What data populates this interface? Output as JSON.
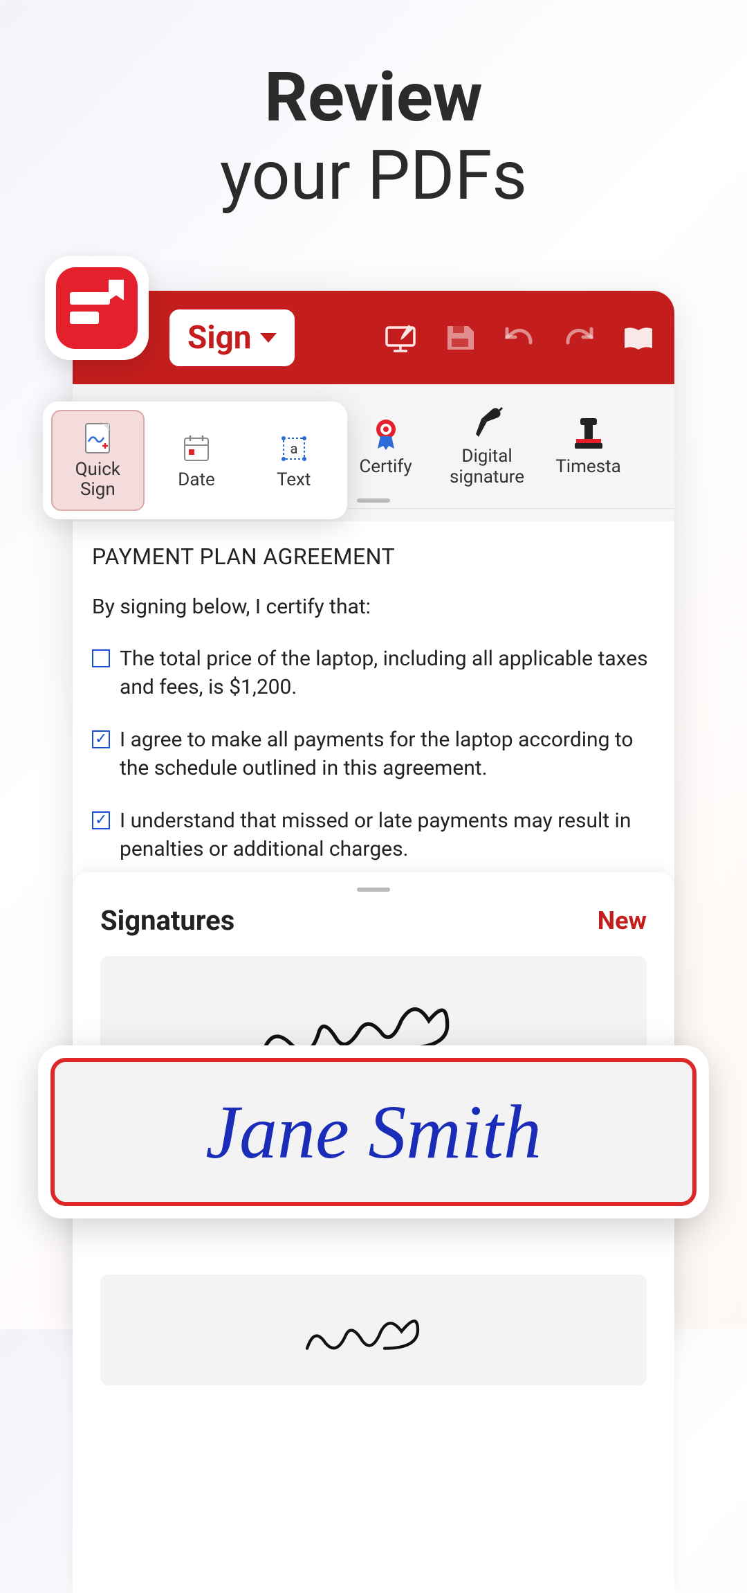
{
  "headline": {
    "line1": "Review",
    "line2": "your PDFs"
  },
  "toolbar": {
    "sign_label": "Sign"
  },
  "floating_ribbon": {
    "items": [
      {
        "label": "Quick\nSign",
        "icon": "quick-sign"
      },
      {
        "label": "Date",
        "icon": "date"
      },
      {
        "label": "Text",
        "icon": "text"
      }
    ]
  },
  "ribbon": {
    "items": [
      {
        "label": "Certify",
        "icon": "certify"
      },
      {
        "label": "Digital\nsignature",
        "icon": "digital-sig"
      },
      {
        "label": "Timesta",
        "icon": "timestamp"
      }
    ]
  },
  "document": {
    "title": "PAYMENT PLAN AGREEMENT",
    "intro": "By signing below, I certify that:",
    "items": [
      {
        "checked": false,
        "text": "The total price of the laptop, including all applicable taxes and fees, is $1,200."
      },
      {
        "checked": true,
        "text": "I agree to make all payments for the laptop according to the schedule outlined in this agreement."
      },
      {
        "checked": true,
        "text": "I understand that missed or late payments may result in penalties or additional charges."
      }
    ]
  },
  "signatures": {
    "title": "Signatures",
    "new_label": "New",
    "highlighted_name": "Jane Smith"
  },
  "colors": {
    "brand_red": "#c31d1d",
    "accent_red": "#e4202c",
    "checkbox_blue": "#1a4dd8",
    "signature_blue": "#1a2db8"
  }
}
